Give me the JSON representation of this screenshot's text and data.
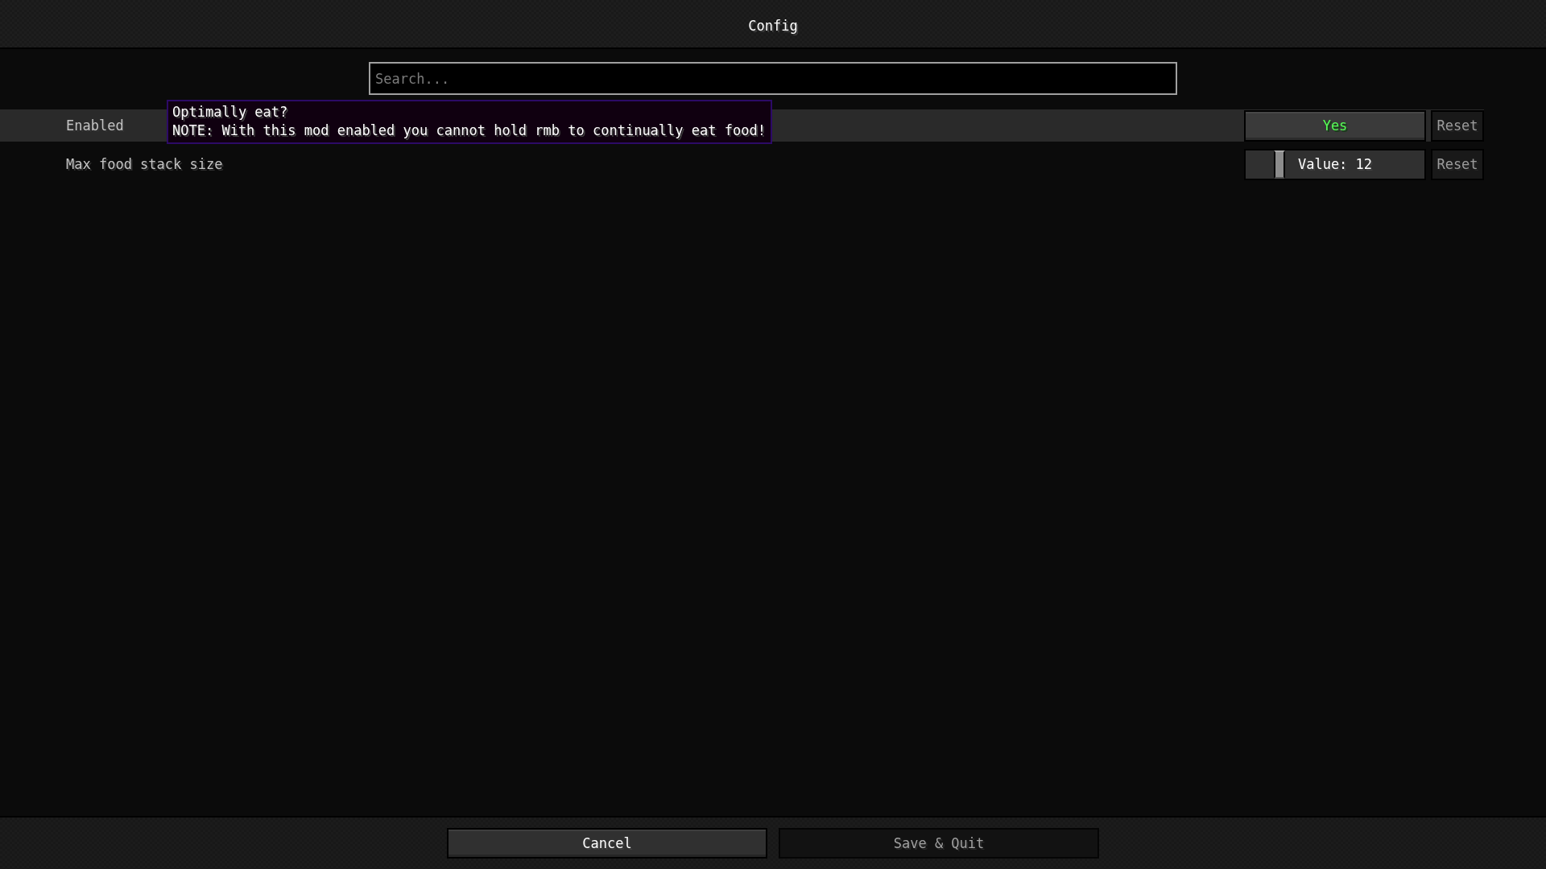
{
  "window": {
    "title": "Config"
  },
  "search": {
    "placeholder": "Search..."
  },
  "entries": [
    {
      "kind": "toggle",
      "label": "Enabled",
      "highlighted": true,
      "value": "Yes",
      "on": true,
      "reset": {
        "label": "Reset",
        "disabled": true
      },
      "tooltip": [
        "Optimally eat?",
        "NOTE: With this mod enabled you cannot hold rmb to continually eat food!"
      ]
    },
    {
      "kind": "slider",
      "label": "Max food stack size",
      "highlighted": false,
      "value": "Value: 12",
      "level": 0.17,
      "reset": {
        "label": "Reset",
        "disabled": true
      }
    }
  ],
  "buttons": [
    {
      "label": "Cancel",
      "disabled": false
    },
    {
      "label": "Save & Quit",
      "disabled": true
    }
  ]
}
